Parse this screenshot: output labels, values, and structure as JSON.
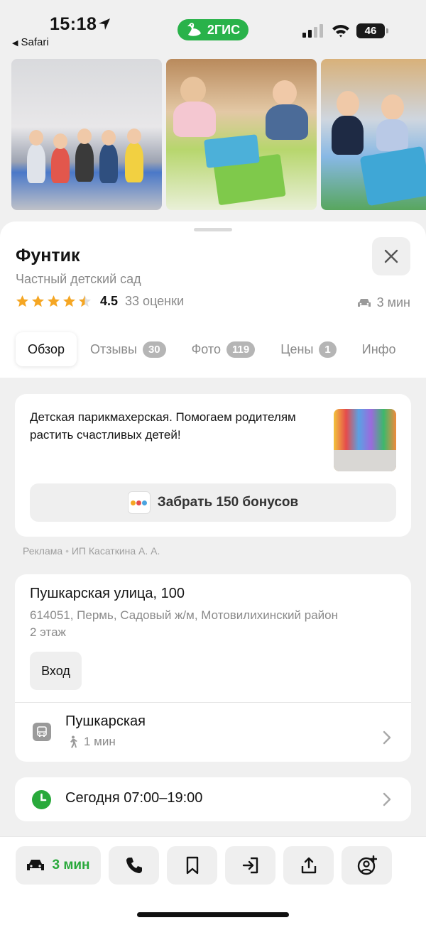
{
  "status_bar": {
    "time": "15:18",
    "back_app": "Safari",
    "app_pill": "2ГИС",
    "battery": "46",
    "accent": "#29b24a"
  },
  "photos": [
    {
      "description_icon": "photo-children-sitting"
    },
    {
      "description_icon": "photo-children-books"
    },
    {
      "description_icon": "photo-children-puzzle"
    }
  ],
  "place": {
    "name": "Фунтик",
    "category": "Частный детский сад",
    "rating": "4.5",
    "rating_value": 4.5,
    "rating_count": "33 оценки",
    "drive_time": "3 мин"
  },
  "tabs": [
    {
      "label": "Обзор",
      "badge": ""
    },
    {
      "label": "Отзывы",
      "badge": "30"
    },
    {
      "label": "Фото",
      "badge": "119"
    },
    {
      "label": "Цены",
      "badge": "1"
    },
    {
      "label": "Инфо",
      "badge": ""
    }
  ],
  "promo": {
    "text": "Детская парикмахерская. Помогаем родителям растить счастливых детей!",
    "button_label": "Забрать 150 бонусов",
    "ad_label": "Реклама",
    "ad_owner": "ИП Касаткина А. А."
  },
  "address": {
    "street": "Пушкарская улица, 100",
    "details": "614051, Пермь, Садовый ж/м, Мотовилихинский район",
    "floor": "2 этаж",
    "entrance_label": "Вход",
    "stop_name": "Пушкарская",
    "walk_time": "1 мин"
  },
  "hours": {
    "text": "Сегодня 07:00–19:00",
    "status_color": "#29a93b"
  },
  "bottom_actions": {
    "route_time": "3 мин",
    "icons": [
      "car-icon",
      "phone-icon",
      "bookmark-icon",
      "entrance-icon",
      "share-icon",
      "add-contact-icon"
    ]
  }
}
